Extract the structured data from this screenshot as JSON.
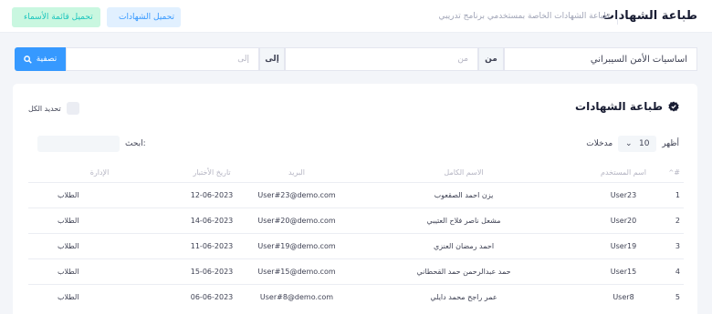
{
  "header": {
    "title": "طباعة الشهادات",
    "subtitle": "طباعة الشهادات الخاصة بمستخدمي برنامج تدريبي",
    "btn_download_certs": "تحميل الشهادات",
    "btn_download_names": "تحميل قائمة الأسماء"
  },
  "filter": {
    "course_value": "اساسيات الأمن السيبراني",
    "from_label": "من",
    "from_placeholder": "من",
    "to_label": "إلى",
    "to_placeholder": "إلى",
    "filter_button": "تصفية"
  },
  "card": {
    "title": "طباعة الشهادات",
    "select_all": "تحديد الكل",
    "show_label": "أظهر",
    "page_size": "10",
    "entries_label": "مدخلات",
    "search_label": "ابحث:"
  },
  "table": {
    "headers": [
      "#",
      "اسم المستخدم",
      "الاسم الكامل",
      "البريد",
      "تاريخ الأختبار",
      "الإدارة"
    ],
    "rows": [
      {
        "num": "1",
        "user": "User23",
        "name": "يزن احمد الصقعوب",
        "email": "User#23@demo.com",
        "date": "12-06-2023",
        "dept": "الطلاب"
      },
      {
        "num": "2",
        "user": "User20",
        "name": "مشعل ناصر فلاح العتيبي",
        "email": "User#20@demo.com",
        "date": "14-06-2023",
        "dept": "الطلاب"
      },
      {
        "num": "3",
        "user": "User19",
        "name": "احمد رمضان العنزي",
        "email": "User#19@demo.com",
        "date": "11-06-2023",
        "dept": "الطلاب"
      },
      {
        "num": "4",
        "user": "User15",
        "name": "حمد عبدالرحمن حمد القحطاني",
        "email": "User#15@demo.com",
        "date": "15-06-2023",
        "dept": "الطلاب"
      },
      {
        "num": "5",
        "user": "User8",
        "name": "عمر راجح محمد دايلي",
        "email": "User#8@demo.com",
        "date": "06-06-2023",
        "dept": "الطلاب"
      }
    ]
  },
  "colors": {
    "primary": "#3699ff",
    "success_light": "#c9f7e0",
    "success": "#1bc5bd",
    "primary_light": "#e1f0ff"
  }
}
